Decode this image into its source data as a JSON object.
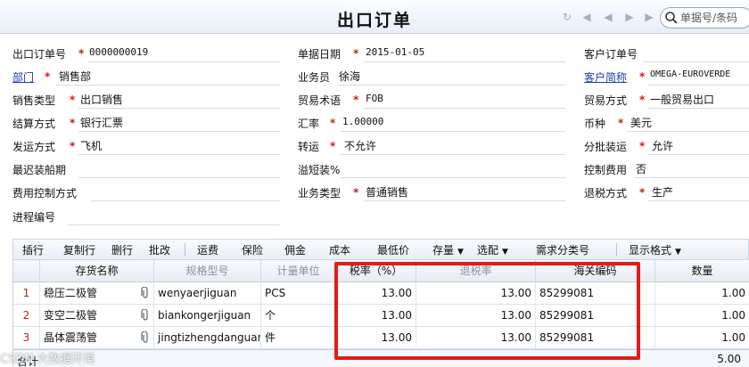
{
  "header": {
    "title": "出口订单",
    "search_placeholder": "单据号/条码",
    "nav_icons": [
      "refresh-icon",
      "first-page-icon",
      "prev-page-icon",
      "next-page-icon",
      "last-page-icon"
    ]
  },
  "form": {
    "order_no": {
      "label": "出口订单号",
      "value": "0000000019",
      "required": true
    },
    "doc_date": {
      "label": "单据日期",
      "value": "2015-01-05",
      "required": true
    },
    "customer_order_no": {
      "label": "客户订单号",
      "value": ""
    },
    "department": {
      "label": "部门",
      "value": "销售部",
      "required": true
    },
    "salesperson": {
      "label": "业务员",
      "value": "徐海"
    },
    "customer_short": {
      "label": "客户简称",
      "value": "OMEGA-EUROVERDE",
      "required": true
    },
    "sales_type": {
      "label": "销售类型",
      "value": "出口销售",
      "required": true
    },
    "trade_terms": {
      "label": "贸易术语",
      "value": "FOB",
      "required": true
    },
    "trade_mode": {
      "label": "贸易方式",
      "value": "一般贸易出口",
      "required": true
    },
    "settlement": {
      "label": "结算方式",
      "value": "银行汇票",
      "required": true
    },
    "exchange_rate": {
      "label": "汇率",
      "value": "1.00000",
      "required": true
    },
    "currency": {
      "label": "币种",
      "value": "美元",
      "required": true
    },
    "shipping": {
      "label": "发运方式",
      "value": "飞机",
      "required": true
    },
    "transshipment": {
      "label": "转运",
      "value": "不允许",
      "required": true
    },
    "partial_shipment": {
      "label": "分批装运",
      "value": "允许",
      "required": true
    },
    "latest_ship": {
      "label": "最迟装船期",
      "value": ""
    },
    "overshort": {
      "label": "溢短装%",
      "value": ""
    },
    "control_fee": {
      "label": "控制费用",
      "value": "否"
    },
    "fee_control_method": {
      "label": "费用控制方式",
      "value": ""
    },
    "business_type": {
      "label": "业务类型",
      "value": "普通销售",
      "required": true
    },
    "tax_refund_method": {
      "label": "退税方式",
      "value": "生产",
      "required": true
    },
    "process_no": {
      "label": "进程编号",
      "value": ""
    }
  },
  "toolbar": {
    "items": [
      "插行",
      "复制行",
      "删行",
      "批改",
      "运费",
      "保险",
      "佣金",
      "成本",
      "最低价",
      "存量",
      "选配",
      "需求分类号",
      "显示格式"
    ]
  },
  "grid": {
    "columns": [
      "存货名称",
      "规格型号",
      "计量单位",
      "税率（%）",
      "退税率",
      "海关编码",
      "数量"
    ],
    "rows": [
      {
        "no": "1",
        "name": "稳压二极管",
        "spec": "wenyaerjiguan",
        "unit": "PCS",
        "tax_rate": "13.00",
        "refund_rate": "13.00",
        "hs_code": "85299081",
        "qty": "1.00"
      },
      {
        "no": "2",
        "name": "变空二极管",
        "spec": "biankongerjiguan",
        "unit": "个",
        "tax_rate": "13.00",
        "refund_rate": "13.00",
        "hs_code": "85299081",
        "qty": "1.00"
      },
      {
        "no": "3",
        "name": "晶体震荡管",
        "spec": "jingtizhengdanguan",
        "unit": "件",
        "tax_rate": "13.00",
        "refund_rate": "13.00",
        "hs_code": "85299081",
        "qty": "1.00"
      }
    ],
    "total_label": "合计",
    "total_qty": "5.00"
  },
  "watermark": "CSDN 大数据环境"
}
